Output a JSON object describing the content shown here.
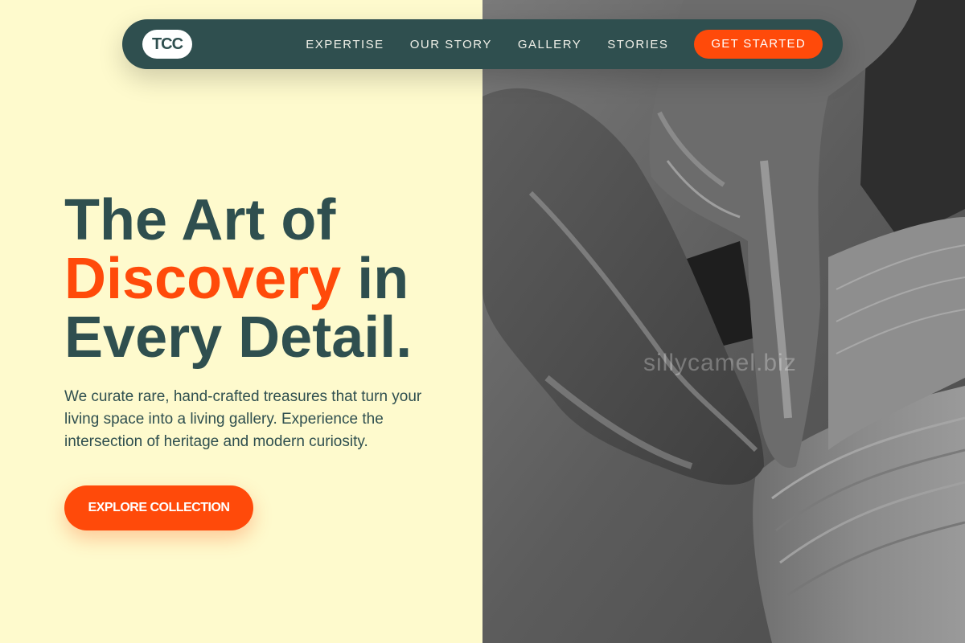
{
  "nav": {
    "logo": "TCC",
    "links": [
      "EXPERTISE",
      "OUR STORY",
      "GALLERY",
      "STORIES"
    ],
    "cta": "GET STARTED"
  },
  "hero": {
    "title_line1": "The Art of",
    "title_accent": "Discovery",
    "title_line2_rest": " in",
    "title_line3": "Every Detail.",
    "description": "We curate rare, hand-crafted treasures that turn your living space into a living gallery. Experience the intersection of heritage and modern curiosity.",
    "button": "EXPLORE COLLECTION"
  },
  "image": {
    "watermark": "sillycamel.biz"
  },
  "colors": {
    "background": "#fefacd",
    "dark": "#2f4f4f",
    "accent": "#ff4a0a"
  }
}
